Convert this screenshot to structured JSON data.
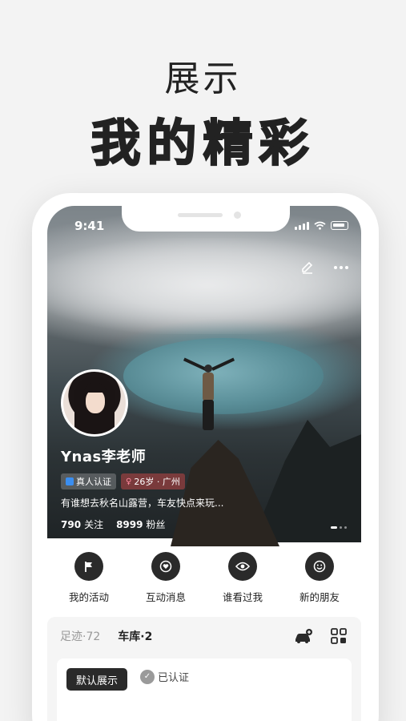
{
  "headline": {
    "line1": "展示",
    "line2": "我的精彩"
  },
  "status_bar": {
    "time": "9:41"
  },
  "profile": {
    "username": "Ynas李老师",
    "badge_verified": "真人认证",
    "badge_info": "26岁 · 广州",
    "bio": "有谁想去秋名山露营，车友快点来玩...",
    "following_count": "790",
    "following_label": "关注",
    "fans_count": "8999",
    "fans_label": "粉丝"
  },
  "quick_actions": [
    {
      "label": "我的活动",
      "icon": "flag-icon"
    },
    {
      "label": "互动消息",
      "icon": "heart-icon"
    },
    {
      "label": "谁看过我",
      "icon": "eye-icon"
    },
    {
      "label": "新的朋友",
      "icon": "smile-icon"
    }
  ],
  "garage": {
    "tab_footprint": "足迹·72",
    "tab_garage": "车库·2",
    "default_label": "默认展示",
    "cert_label": "已认证"
  },
  "colors": {
    "accent_dark": "#2a2a2a",
    "verify_blue": "#3a8ef0",
    "background": "#f3f3f3"
  }
}
